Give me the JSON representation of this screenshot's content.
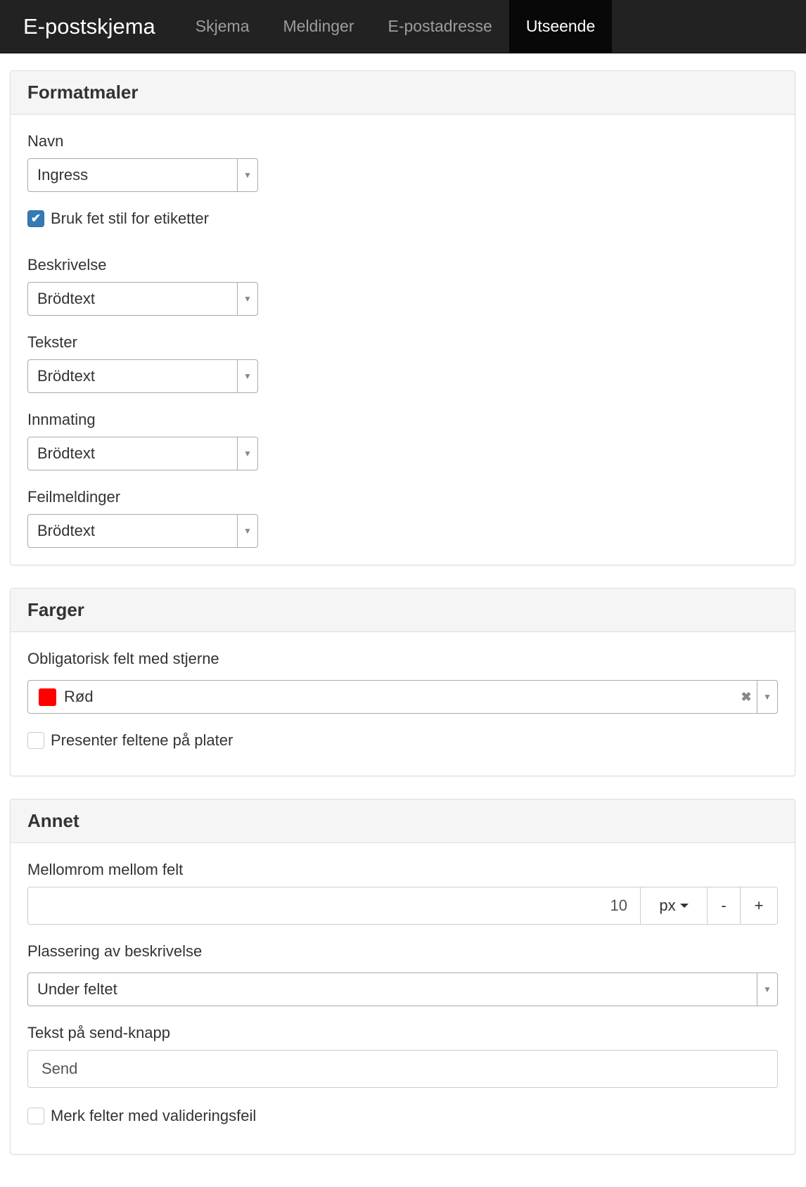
{
  "navbar": {
    "brand": "E-postskjema",
    "tabs": [
      {
        "label": "Skjema",
        "active": false
      },
      {
        "label": "Meldinger",
        "active": false
      },
      {
        "label": "E-postadresse",
        "active": false
      },
      {
        "label": "Utseende",
        "active": true
      }
    ]
  },
  "formatmaler": {
    "title": "Formatmaler",
    "navn_label": "Navn",
    "navn_value": "Ingress",
    "bold_labels_text": "Bruk fet stil for etiketter",
    "bold_labels_checked": true,
    "beskrivelse_label": "Beskrivelse",
    "beskrivelse_value": "Brödtext",
    "tekster_label": "Tekster",
    "tekster_value": "Brödtext",
    "innmating_label": "Innmating",
    "innmating_value": "Brödtext",
    "feilmeldinger_label": "Feilmeldinger",
    "feilmeldinger_value": "Brödtext"
  },
  "farger": {
    "title": "Farger",
    "required_label": "Obligatorisk felt med stjerne",
    "required_value": "Rød",
    "required_color": "#ff0000",
    "tiles_text": "Presenter feltene på plater",
    "tiles_checked": false
  },
  "annet": {
    "title": "Annet",
    "spacing_label": "Mellomrom mellom felt",
    "spacing_value": "10",
    "spacing_unit": "px",
    "minus_label": "-",
    "plus_label": "+",
    "placement_label": "Plassering av beskrivelse",
    "placement_value": "Under feltet",
    "send_label": "Tekst på send-knapp",
    "send_value": "Send",
    "validation_text": "Merk felter med valideringsfeil",
    "validation_checked": false
  },
  "icons": {
    "dropdown_arrow": "▼",
    "clear": "✖",
    "check": "✔"
  }
}
